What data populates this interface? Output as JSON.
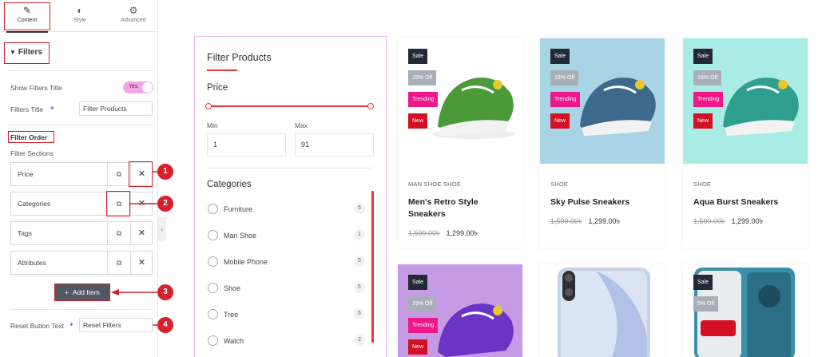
{
  "panel": {
    "tabs": [
      {
        "label": "Content",
        "icon": "pencil-icon"
      },
      {
        "label": "Style",
        "icon": "contrast-icon"
      },
      {
        "label": "Advanced",
        "icon": "gear-icon"
      }
    ],
    "section_label": "Filters",
    "show_filters_title_label": "Show Filters Title",
    "show_filters_title_value": "Yes",
    "filters_title_label": "Filters Title",
    "filters_title_value": "Filter Products",
    "filter_order_label": "Filter Order",
    "filter_sections_label": "Filter Sections",
    "items": [
      {
        "label": "Price"
      },
      {
        "label": "Categories"
      },
      {
        "label": "Tags"
      },
      {
        "label": "Attributes"
      }
    ],
    "add_item_label": "Add Item",
    "reset_button_label": "Reset Button Text",
    "reset_button_value": "Reset Filters",
    "markers": [
      "1",
      "2",
      "3",
      "4"
    ],
    "accent_color": "#d6202b"
  },
  "filter_box": {
    "title": "Filter Products",
    "price_heading": "Price",
    "price_range": {
      "min": 0,
      "max": 1,
      "selected_low": 0,
      "selected_high": 1
    },
    "min_label": "Min",
    "min_value": "1",
    "max_label": "Max",
    "max_value": "91",
    "categories_heading": "Categories",
    "categories": [
      {
        "name": "Furniture",
        "count": "5"
      },
      {
        "name": "Man Shoe",
        "count": "1"
      },
      {
        "name": "Mobile Phone",
        "count": "5"
      },
      {
        "name": "Shoe",
        "count": "5"
      },
      {
        "name": "Tree",
        "count": "5"
      },
      {
        "name": "Watch",
        "count": "2"
      }
    ]
  },
  "products": [
    {
      "category": "MAN SHOE  SHOE",
      "name": "Men's Retro Style Sneakers",
      "old_price": "1,599.00৳",
      "new_price": "1,299.00৳",
      "badges": [
        "Sale",
        "19% Off",
        "Trending",
        "New"
      ],
      "bg": "#ffffff",
      "shoe_color": "#4a9a3a"
    },
    {
      "category": "SHOE",
      "name": "Sky Pulse Sneakers",
      "old_price": "1,599.00৳",
      "new_price": "1,299.00৳",
      "badges": [
        "Sale",
        "19% Off",
        "Trending",
        "New"
      ],
      "bg": "#a8d4e6",
      "shoe_color": "#3d6a8c"
    },
    {
      "category": "SHOE",
      "name": "Aqua Burst Sneakers",
      "old_price": "1,599.00৳",
      "new_price": "1,299.00৳",
      "badges": [
        "Sale",
        "19% Off",
        "Trending",
        "New"
      ],
      "bg": "#a9ece4",
      "shoe_color": "#2f9e8f"
    },
    {
      "badges": [
        "Sale",
        "19% Off",
        "Trending",
        "New"
      ],
      "bg": "#c59be6",
      "shoe_color": "#6a34c4"
    },
    {
      "badges": [],
      "bg": "#ffffff"
    },
    {
      "badges": [
        "Sale",
        "5% Off"
      ],
      "bg": "#ffffff"
    }
  ]
}
